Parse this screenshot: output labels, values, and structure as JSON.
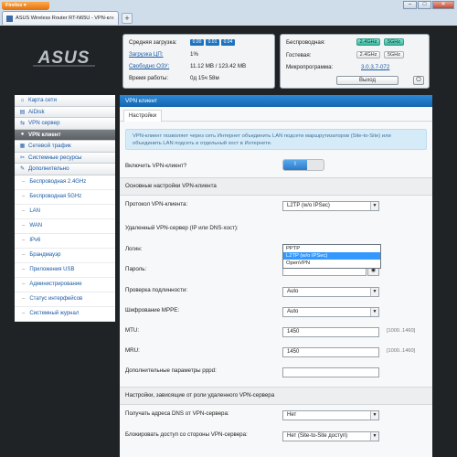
{
  "browser": {
    "menu_button": "Firefox ▾",
    "tab_title": "ASUS Wireless Router RT-N65U - VPN-кл...",
    "tab_close": "×",
    "new_tab": "+",
    "controls": [
      "–",
      "□",
      "✕"
    ]
  },
  "header": {
    "logo": "ASUS",
    "labels": {
      "load": "Средняя загрузка:",
      "cpu": "Загрузка ЦП:",
      "ram": "Свободно ОЗУ:",
      "uptime": "Время работы:",
      "wireless": "Беспроводная:",
      "guest": "Гостевая:",
      "firmware": "Микропрограмма:"
    },
    "values": {
      "load": [
        "0.00",
        "0.01",
        "0.04"
      ],
      "cpu": "1%",
      "ram": "11.12 MB / 123.42 MB",
      "uptime": "0д 15ч 58м",
      "wireless_bands": [
        "2.4GHz",
        "5GHz"
      ],
      "guest_bands": [
        "2.4GHz",
        "5GHz"
      ],
      "firmware": "3.0.3.7-072"
    },
    "exit_button": "Выход",
    "power_icon": "⏻"
  },
  "sidebar": {
    "items": [
      {
        "label": "Карта сети",
        "icon": "home-icon",
        "glyph": "⌂"
      },
      {
        "label": "AiDisk",
        "icon": "disk-icon",
        "glyph": "▤"
      },
      {
        "label": "VPN сервер",
        "icon": "vpn-icon",
        "glyph": "⇆"
      },
      {
        "label": "VPN клиент",
        "icon": "globe-icon",
        "glyph": "●",
        "active": true
      },
      {
        "label": "Сетевой трафик",
        "icon": "traffic-icon",
        "glyph": "▦"
      },
      {
        "label": "Системные ресурсы",
        "icon": "resources-icon",
        "glyph": "✂"
      },
      {
        "label": "Дополнительно",
        "icon": "wrench-icon",
        "glyph": "✎"
      }
    ],
    "sub_items": [
      "Беспроводная 2.4GHz",
      "Беспроводная 5GHz",
      "LAN",
      "WAN",
      "IPv6",
      "Брандмауэр",
      "Приложения USB",
      "Администрирование",
      "Статус интерфейсов",
      "Системный журнал"
    ]
  },
  "main": {
    "title": "VPN клиент",
    "subtab": "Настройки",
    "notice": "VPN-клиент позволяет через сеть Интернет объединить LAN подсети маршрутизаторов (Site-to-Site) или объединить LAN подсеть и отдельный хост в Интернете.",
    "enable_label": "Включить VPN-клиент?",
    "enable_toggle": "I",
    "section_basic": "Основные настройки VPN-клиента",
    "protocol_label": "Протокол VPN-клиента:",
    "protocol_value": "L2TP (w/o IPSec)",
    "protocol_options": [
      "PPTP",
      "L2TP (w/o IPSec)",
      "OpenVPN"
    ],
    "protocol_selected_index": 1,
    "server_label": "Удаленный VPN-сервер (IP или DNS-хост):",
    "login_label": "Логин:",
    "password_label": "Пароль:",
    "auth_label": "Проверка подлинности:",
    "auth_value": "Auto",
    "mppe_label": "Шифрование MPPE:",
    "mppe_value": "Auto",
    "mtu_label": "MTU:",
    "mtu_value": "1450",
    "mtu_hint": "[1000..1460]",
    "mru_label": "MRU:",
    "mru_value": "1450",
    "mru_hint": "[1000..1460]",
    "pppd_label": "Дополнительные параметры pppd:",
    "section_role": "Настройки, зависящие от роли удаленного VPN-сервера",
    "dns_label": "Получать адреса DNS от VPN-сервера:",
    "dns_value": "Нет",
    "block_label": "Блокировать доступ со стороны VPN-сервера:",
    "block_value": "Нет (Site-to-Site доступ)"
  }
}
